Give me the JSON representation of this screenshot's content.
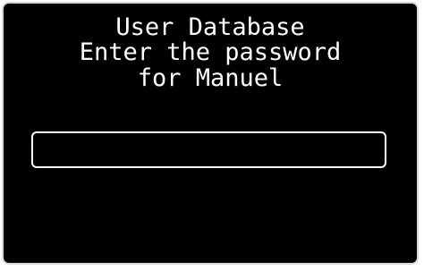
{
  "dialog": {
    "title": "User Database",
    "prompt_line_1": "Enter the password",
    "prompt_line_2": "for Manuel"
  },
  "password_input": {
    "value": ""
  },
  "colors": {
    "background": "#000000",
    "text": "#ffffff",
    "frame": "#d8d8d8"
  }
}
